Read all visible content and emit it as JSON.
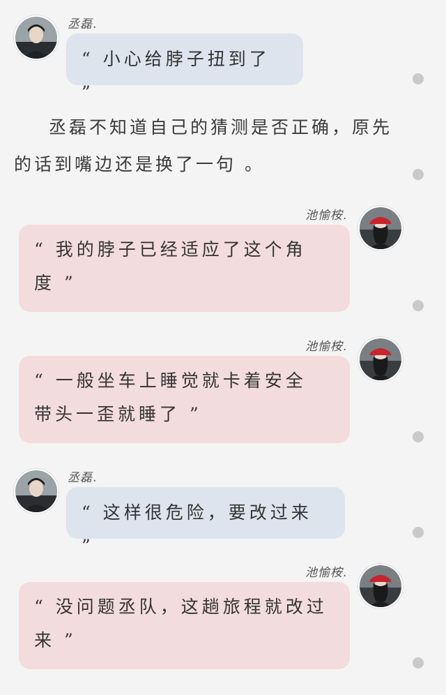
{
  "messages": [
    {
      "speaker": "丞磊.",
      "text": "“ 小心给脖子扭到了 ”"
    },
    {
      "narration": "丞磊不知道自己的猜测是否正确，原先的话到嘴边还是换了一句 。"
    },
    {
      "speaker": "池愉桉.",
      "text": "“ 我的脖子已经适应了这个角度 ”"
    },
    {
      "speaker": "池愉桉.",
      "text": "“ 一般坐车上睡觉就卡着安全带头一歪就睡了 ”"
    },
    {
      "speaker": "丞磊.",
      "text": "“ 这样很危险，要改过来 ”"
    },
    {
      "speaker": "池愉桉.",
      "text": "“ 没问题丞队，这趟旅程就改过来 ”"
    }
  ],
  "colors": {
    "background": "#f4f4f4",
    "bubble_male": "#dde4ee",
    "bubble_female": "#f3dcdd",
    "dot": "#c9c9c9"
  },
  "icons": {
    "avatar_male": "avatar-male-icon",
    "avatar_female": "avatar-female-icon",
    "dot": "status-dot-icon"
  }
}
